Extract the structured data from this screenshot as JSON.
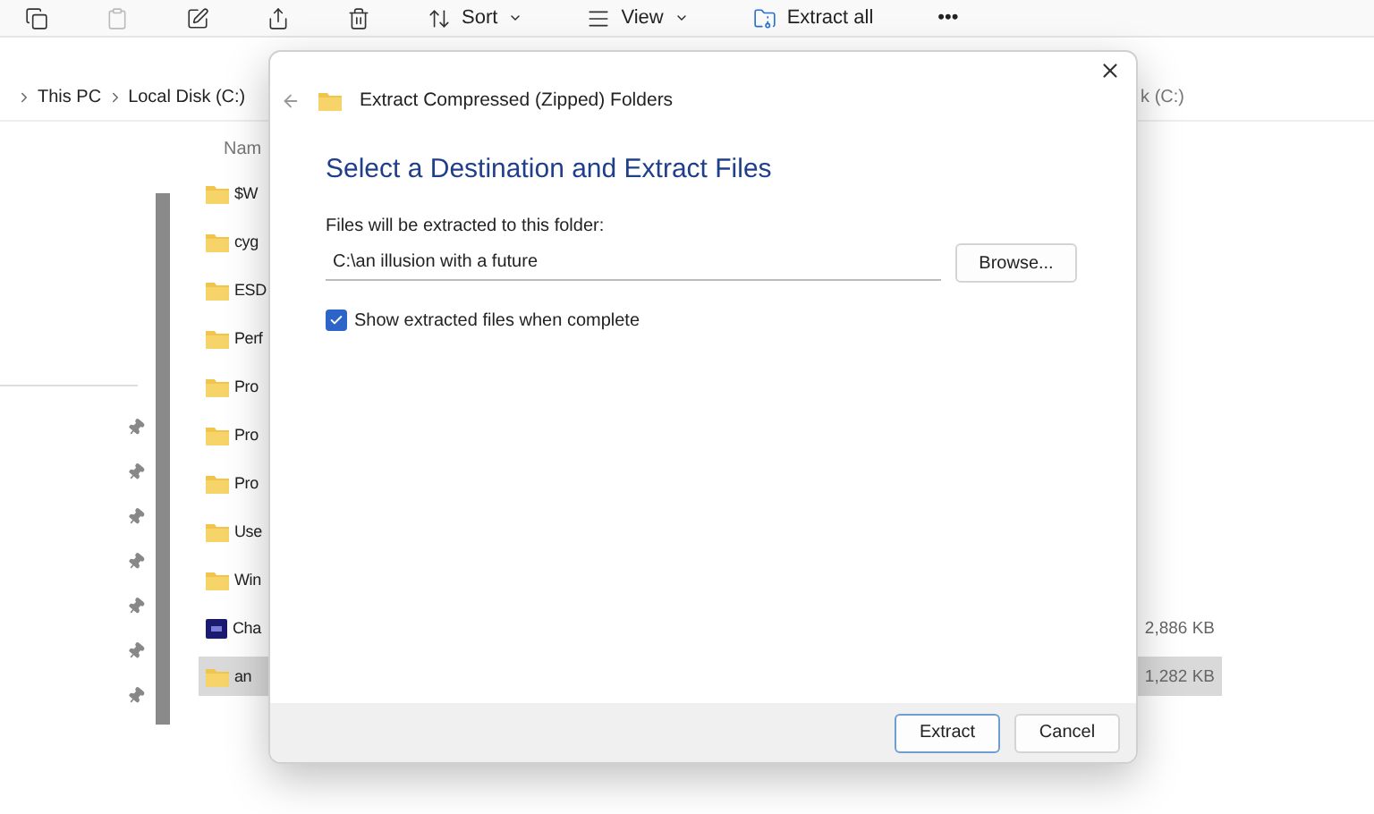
{
  "toolbar": {
    "buttons": [
      {
        "kind": "copy",
        "disabled": false
      },
      {
        "kind": "paste",
        "disabled": true
      },
      {
        "kind": "rename",
        "disabled": false
      },
      {
        "kind": "share",
        "disabled": false
      },
      {
        "kind": "delete",
        "disabled": false
      },
      {
        "kind": "sort",
        "label": "Sort",
        "disabled": false
      },
      {
        "kind": "view",
        "label": "View",
        "disabled": false
      },
      {
        "kind": "extract",
        "label": "Extract all",
        "disabled": false
      },
      {
        "kind": "more",
        "label": "•••",
        "disabled": false
      }
    ]
  },
  "breadcrumb": {
    "items": [
      "This PC",
      "Local Disk (C:)"
    ],
    "right_fragment": "k (C:)"
  },
  "file_list": {
    "column_header": "Nam",
    "rows": [
      {
        "name": "$W",
        "kind": "folder",
        "selected": false
      },
      {
        "name": "cyg",
        "kind": "folder",
        "selected": false
      },
      {
        "name": "ESD",
        "kind": "folder",
        "selected": false
      },
      {
        "name": "Perf",
        "kind": "folder",
        "selected": false
      },
      {
        "name": "Pro",
        "kind": "folder",
        "selected": false
      },
      {
        "name": "Pro",
        "kind": "folder",
        "selected": false
      },
      {
        "name": "Pro",
        "kind": "folder",
        "selected": false
      },
      {
        "name": "Use",
        "kind": "folder",
        "selected": false
      },
      {
        "name": "Win",
        "kind": "folder",
        "selected": false
      },
      {
        "name": "Cha",
        "kind": "app",
        "size": "2,886 KB",
        "selected": false
      },
      {
        "name": "an",
        "kind": "zip",
        "size": "1,282 KB",
        "selected": true
      }
    ]
  },
  "dialog": {
    "title": "Extract Compressed (Zipped) Folders",
    "heading": "Select a Destination and Extract Files",
    "field_label": "Files will be extracted to this folder:",
    "path": "C:\\an illusion with a future",
    "browse": "Browse...",
    "show_files": {
      "label": "Show extracted files when complete",
      "checked": true
    },
    "buttons": [
      {
        "label": "Extract",
        "default": true
      },
      {
        "label": "Cancel",
        "default": false
      }
    ]
  }
}
